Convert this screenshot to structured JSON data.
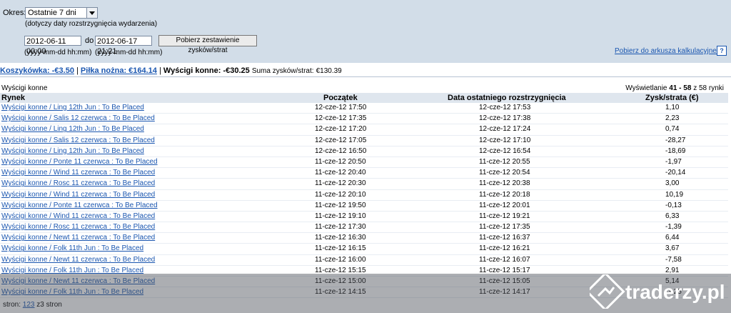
{
  "filters": {
    "period_label": "Okres:",
    "period_value": "Ostatnie 7 dni",
    "period_note": "(dotyczy daty rozstrzygnięcia wydarzenia)",
    "from_value": "2012-06-11 00:00",
    "to_label": "do",
    "to_value": "2012-06-17 21:21",
    "date_format_from": "(yyyy-mm-dd hh:mm)",
    "date_format_to": "(yyyy-mm-dd hh:mm)",
    "submit_label": "Pobierz zestawienie zysków/strat",
    "export_link": "Pobierz do arkusza kalkulacyjnego",
    "help_label": "?"
  },
  "summary": {
    "basketball": "Koszykówka: -€3.50",
    "football": "Piłka nożna: €164.14",
    "horses": "Wyścigi konne: -€30.25",
    "total_label": "Suma zysków/strat:",
    "total_value": "€130.39",
    "sep": "|"
  },
  "table": {
    "section_title": "Wyścigi konne",
    "showing_prefix": "Wyświetlanie",
    "showing_range": "41 - 58",
    "showing_suffix": "z 58 rynki",
    "headers": [
      "Rynek",
      "Początek",
      "Data ostatniego rozstrzygnięcia",
      "Zysk/strata (€)"
    ],
    "rows": [
      [
        "Wyścigi konne / Ling 12th Jun : To Be Placed",
        "12-cze-12 17:50",
        "12-cze-12 17:53",
        "1,10"
      ],
      [
        "Wyścigi konne / Salis 12 czerwca : To Be Placed",
        "12-cze-12 17:35",
        "12-cze-12 17:38",
        "2,23"
      ],
      [
        "Wyścigi konne / Ling 12th Jun : To Be Placed",
        "12-cze-12 17:20",
        "12-cze-12 17:24",
        "0,74"
      ],
      [
        "Wyścigi konne / Salis 12 czerwca : To Be Placed",
        "12-cze-12 17:05",
        "12-cze-12 17:10",
        "-28,27"
      ],
      [
        "Wyścigi konne / Ling 12th Jun : To Be Placed",
        "12-cze-12 16:50",
        "12-cze-12 16:54",
        "-18,69"
      ],
      [
        "Wyścigi konne / Ponte 11 czerwca : To Be Placed",
        "11-cze-12 20:50",
        "11-cze-12 20:55",
        "-1,97"
      ],
      [
        "Wyścigi konne / Wind 11 czerwca : To Be Placed",
        "11-cze-12 20:40",
        "11-cze-12 20:54",
        "-20,14"
      ],
      [
        "Wyścigi konne / Rosc 11 czerwca : To Be Placed",
        "11-cze-12 20:30",
        "11-cze-12 20:38",
        "3,00"
      ],
      [
        "Wyścigi konne / Wind 11 czerwca : To Be Placed",
        "11-cze-12 20:10",
        "11-cze-12 20:18",
        "10,19"
      ],
      [
        "Wyścigi konne / Ponte 11 czerwca : To Be Placed",
        "11-cze-12 19:50",
        "11-cze-12 20:01",
        "-0,13"
      ],
      [
        "Wyścigi konne / Wind 11 czerwca : To Be Placed",
        "11-cze-12 19:10",
        "11-cze-12 19:21",
        "6,33"
      ],
      [
        "Wyścigi konne / Rosc 11 czerwca : To Be Placed",
        "11-cze-12 17:30",
        "11-cze-12 17:35",
        "-1,39"
      ],
      [
        "Wyścigi konne / Newt 11 czerwca : To Be Placed",
        "11-cze-12 16:30",
        "11-cze-12 16:37",
        "6,44"
      ],
      [
        "Wyścigi konne / Folk 11th Jun : To Be Placed",
        "11-cze-12 16:15",
        "11-cze-12 16:21",
        "3,67"
      ],
      [
        "Wyścigi konne / Newt 11 czerwca : To Be Placed",
        "11-cze-12 16:00",
        "11-cze-12 16:07",
        "-7,58"
      ],
      [
        "Wyścigi konne / Folk 11th Jun : To Be Placed",
        "11-cze-12 15:15",
        "11-cze-12 15:17",
        "2,91"
      ],
      [
        "Wyścigi konne / Newt 11 czerwca : To Be Placed",
        "11-cze-12 15:00",
        "11-cze-12 15:05",
        "5,14"
      ],
      [
        "Wyścigi konne / Folk 11th Jun : To Be Placed",
        "11-cze-12 14:15",
        "11-cze-12 14:17",
        "-3,25"
      ]
    ]
  },
  "pager": {
    "label": "stron:",
    "pages": [
      "1",
      "2",
      "3"
    ],
    "total": "z3 stron"
  },
  "watermark": {
    "logo_text": "traderzy.pl",
    "logo_color": "#ffffff"
  },
  "colors": {
    "link": "#1a56b0",
    "panel": "#d2dde8",
    "header": "#dfe6ee"
  }
}
